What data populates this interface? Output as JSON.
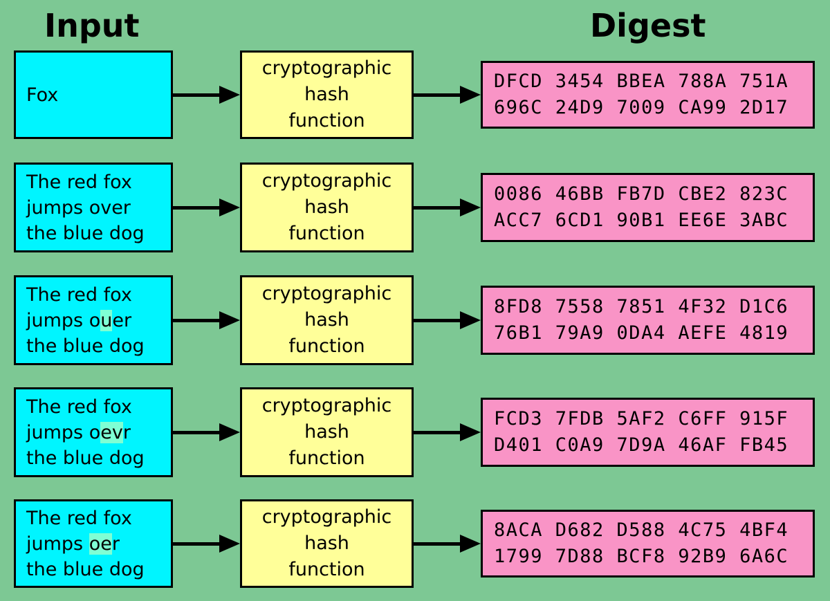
{
  "headers": {
    "input": "Input",
    "digest": "Digest"
  },
  "colors": {
    "background": "#7dc894",
    "input_box": "#00f5ff",
    "function_box": "#ffff99",
    "digest_box": "#f994c6",
    "highlight": "#7fffd4",
    "outline": "#000000"
  },
  "function_label": "cryptographic\nhash\nfunction",
  "rows": [
    {
      "input_prefix": "Fox",
      "input_highlight": "",
      "input_suffix": "",
      "input_plain": "Fox",
      "function": "cryptographic\nhash\nfunction",
      "digest_line1": "DFCD 3454 BBEA 788A 751A",
      "digest_line2": "696C 24D9 7009 CA99 2D17"
    },
    {
      "input_prefix": "The red fox\njumps over\nthe blue dog",
      "input_highlight": "",
      "input_suffix": "",
      "input_plain": "The red fox\njumps over\nthe blue dog",
      "function": "cryptographic\nhash\nfunction",
      "digest_line1": "0086 46BB FB7D CBE2 823C",
      "digest_line2": "ACC7 6CD1 90B1 EE6E 3ABC"
    },
    {
      "input_prefix": "The red fox\njumps o",
      "input_highlight": "u",
      "input_suffix": "er\nthe blue dog",
      "input_plain": "The red fox\njumps ouer\nthe blue dog",
      "function": "cryptographic\nhash\nfunction",
      "digest_line1": "8FD8 7558 7851 4F32 D1C6",
      "digest_line2": "76B1 79A9 0DA4 AEFE 4819"
    },
    {
      "input_prefix": "The red fox\njumps o",
      "input_highlight": "ev",
      "input_suffix": "r\nthe blue dog",
      "input_plain": "The red fox\njumps oevr\nthe blue dog",
      "function": "cryptographic\nhash\nfunction",
      "digest_line1": "FCD3 7FDB 5AF2 C6FF 915F",
      "digest_line2": "D401 C0A9 7D9A 46AF FB45"
    },
    {
      "input_prefix": "The red fox\njumps ",
      "input_highlight": "oe",
      "input_suffix": "r\nthe blue dog",
      "input_plain": "The red fox\njumps oer\nthe blue dog",
      "function": "cryptographic\nhash\nfunction",
      "digest_line1": "8ACA D682 D588 4C75 4BF4",
      "digest_line2": "1799 7D88 BCF8 92B9 6A6C"
    }
  ]
}
